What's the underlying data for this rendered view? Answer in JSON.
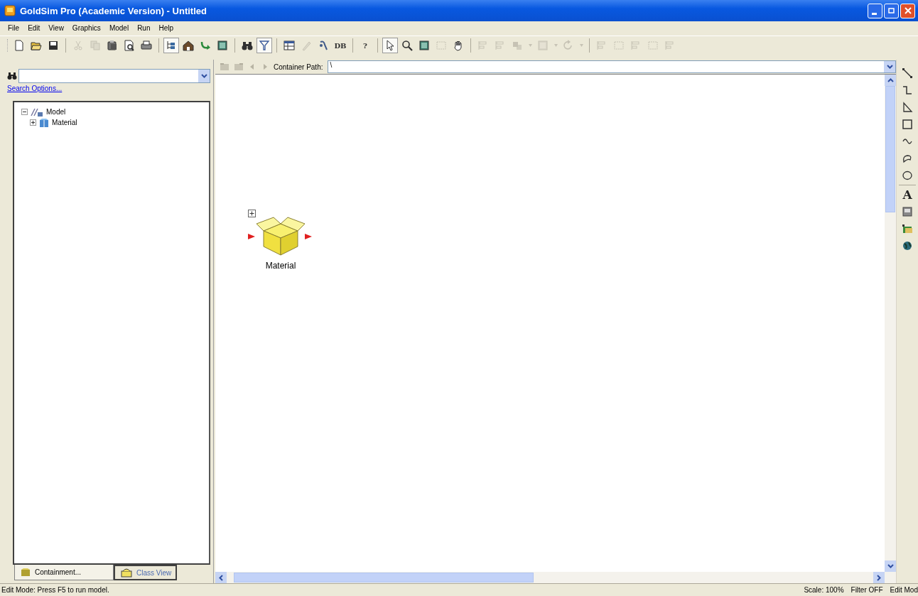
{
  "window": {
    "title": "GoldSim Pro (Academic Version) - Untitled"
  },
  "menu": [
    "File",
    "Edit",
    "View",
    "Graphics",
    "Model",
    "Run",
    "Help"
  ],
  "toolbar": [
    [
      {
        "kind": "new",
        "disabled": false,
        "selected": false
      },
      {
        "kind": "open",
        "disabled": false,
        "selected": false
      },
      {
        "kind": "save",
        "disabled": false,
        "selected": false
      }
    ],
    [
      {
        "kind": "cut",
        "disabled": true,
        "selected": false
      },
      {
        "kind": "copy",
        "disabled": true,
        "selected": false
      },
      {
        "kind": "paste",
        "disabled": false,
        "selected": false
      },
      {
        "kind": "preview",
        "disabled": false,
        "selected": false
      },
      {
        "kind": "print",
        "disabled": false,
        "selected": false
      }
    ],
    [
      {
        "kind": "tree",
        "disabled": false,
        "selected": true
      },
      {
        "kind": "house",
        "disabled": false,
        "selected": false
      },
      {
        "kind": "curve-arrow",
        "disabled": false,
        "selected": false
      },
      {
        "kind": "panel",
        "disabled": false,
        "selected": false
      }
    ],
    [
      {
        "kind": "binoculars",
        "disabled": false,
        "selected": false
      },
      {
        "kind": "filter",
        "disabled": false,
        "selected": true
      }
    ],
    [
      {
        "kind": "table",
        "disabled": false,
        "selected": false
      },
      {
        "kind": "pencil",
        "disabled": true,
        "selected": false
      },
      {
        "kind": "tool",
        "disabled": false,
        "selected": false
      },
      {
        "kind": "glyph",
        "glyph": "DB",
        "disabled": false,
        "selected": false
      }
    ],
    [
      {
        "kind": "glyph",
        "glyph": "?",
        "disabled": false,
        "selected": false
      }
    ],
    [
      {
        "kind": "pointer",
        "disabled": false,
        "selected": true
      },
      {
        "kind": "zoom",
        "disabled": false,
        "selected": false
      },
      {
        "kind": "panel",
        "disabled": false,
        "selected": false
      },
      {
        "kind": "frame",
        "disabled": true,
        "selected": false
      },
      {
        "kind": "hand",
        "disabled": false,
        "selected": false
      }
    ],
    [
      {
        "kind": "align",
        "disabled": true,
        "selected": false
      },
      {
        "kind": "align",
        "disabled": true,
        "selected": false
      },
      {
        "kind": "layers",
        "disabled": true,
        "selected": false
      },
      {
        "kind": "caret",
        "disabled": true,
        "selected": false
      },
      {
        "kind": "panel",
        "disabled": true,
        "selected": false
      },
      {
        "kind": "caret",
        "disabled": true,
        "selected": false
      },
      {
        "kind": "rotate",
        "disabled": true,
        "selected": false
      },
      {
        "kind": "caret",
        "disabled": true,
        "selected": false
      }
    ],
    [
      {
        "kind": "align",
        "disabled": true,
        "selected": false
      },
      {
        "kind": "frame",
        "disabled": true,
        "selected": false
      },
      {
        "kind": "align",
        "disabled": true,
        "selected": false
      },
      {
        "kind": "frame",
        "disabled": true,
        "selected": false
      },
      {
        "kind": "align",
        "disabled": true,
        "selected": false
      }
    ]
  ],
  "search": {
    "link": "Search Options..."
  },
  "tree": [
    {
      "label": "Model",
      "kind": "model",
      "expanded": true,
      "children": [
        {
          "label": "Material",
          "kind": "container",
          "expanded": false
        }
      ]
    }
  ],
  "panel_tabs": [
    {
      "label": "Containment...",
      "kind": "containment",
      "selected": true
    },
    {
      "label": "Class View",
      "kind": "class",
      "selected": false
    }
  ],
  "path_bar": {
    "label": "Container Path:",
    "value": "\\"
  },
  "canvas": {
    "elements": [
      {
        "label": "Material",
        "kind": "container",
        "expanded": false
      }
    ]
  },
  "drawing_tools": [
    {
      "kind": "line"
    },
    {
      "kind": "elbow"
    },
    {
      "kind": "polygon"
    },
    {
      "kind": "rect"
    },
    {
      "kind": "curve"
    },
    {
      "kind": "blob"
    },
    {
      "kind": "ellipse"
    },
    {
      "kind": "glyph",
      "glyph": "A"
    },
    {
      "kind": "image"
    },
    {
      "kind": "folder"
    },
    {
      "kind": "globe"
    }
  ],
  "status_bar": {
    "message": "Edit Mode: Press F5 to run model.",
    "fields": [
      "Scale: 100%",
      "Filter OFF",
      "Edit Mod"
    ]
  }
}
